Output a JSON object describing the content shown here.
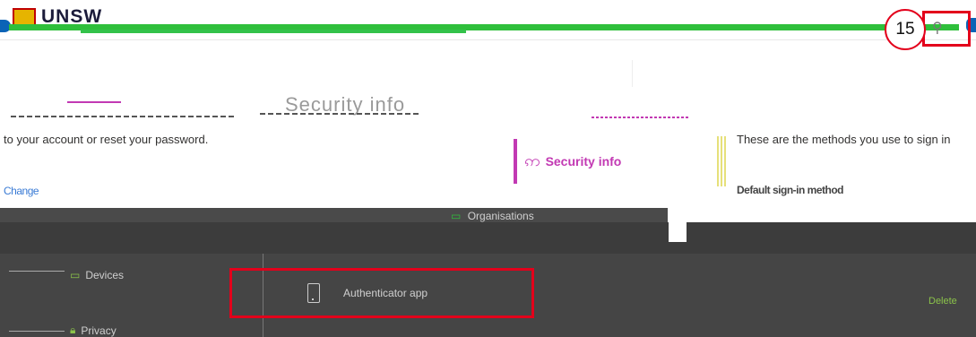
{
  "header": {
    "logo_text": "UNSW",
    "step_number": "15",
    "search_icon": "search-icon"
  },
  "page": {
    "title_fragment": "Security info",
    "account_text": "to your account or reset your password.",
    "methods_text": "These are the methods you use to sign in"
  },
  "sidebar": {
    "security_info_label": "Security info",
    "organisations_label": "Organisations",
    "devices_label": "Devices",
    "privacy_label": "Privacy"
  },
  "methods": {
    "change_link": "Change",
    "default_sign_in": "Default sign-in method",
    "authenticator_label": "Authenticator app",
    "delete_label": "Delete"
  },
  "colors": {
    "accent": "#c239b3",
    "highlight_red": "#e3001b",
    "header_green": "#2fbf3b"
  }
}
